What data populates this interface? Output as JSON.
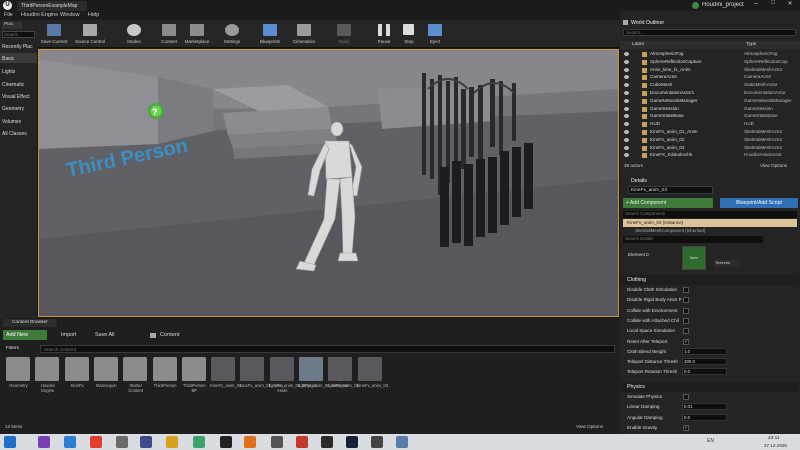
{
  "window": {
    "tab_title": "ThirdPersonExampleMap",
    "project_name": "Houdini_project",
    "menu": [
      "File",
      "Houdini Engine",
      "Window",
      "Help"
    ]
  },
  "modes_panel": {
    "tab": "Plac",
    "search_placeholder": "Search",
    "items": [
      "Recently Plac",
      "Basic",
      "Lights",
      "Cinematic",
      "Visual Effect",
      "Geometry",
      "Volumes",
      "All Classes"
    ]
  },
  "toolbar": {
    "buttons": [
      "Save Current",
      "Source Control",
      "Modes",
      "Content",
      "Marketplace",
      "Settings",
      "Blueprints",
      "Cinematics",
      "Build",
      "Pause",
      "Stop",
      "Eject"
    ]
  },
  "viewport": {
    "floor_text": "Third Person",
    "help_marker": "?"
  },
  "world_outliner": {
    "title": "World Outliner",
    "search_placeholder": "Search...",
    "col_label": "Label",
    "col_type": "Type",
    "rows": [
      {
        "label": "AtmosphericFog",
        "type": "AtmosphericFog"
      },
      {
        "label": "SphereReflectionCapture",
        "type": "SphereReflectionCap"
      },
      {
        "label": "Anim_kine_fx_Anim",
        "type": "SkeletalMeshActor"
      },
      {
        "label": "CameraActor",
        "type": "CameraActor"
      },
      {
        "label": "CubeMesh",
        "type": "StaticMeshActor"
      },
      {
        "label": "DocumentationActor1",
        "type": "DocumentationActor"
      },
      {
        "label": "GameNetworkManager",
        "type": "GameNetworkManager"
      },
      {
        "label": "GameSession",
        "type": "GameSession"
      },
      {
        "label": "GameStateBase",
        "type": "GameStateBase"
      },
      {
        "label": "HUD",
        "type": "HUD"
      },
      {
        "label": "KineFx_anim_01_Anim",
        "type": "SkeletalMeshActor"
      },
      {
        "label": "KineFx_anim_02",
        "type": "SkeletalMeshActor"
      },
      {
        "label": "KineFx_anim_03",
        "type": "SkeletalMeshActor"
      },
      {
        "label": "KineFX_Kilokolmchk",
        "type": "HoudiniAssetActor"
      }
    ],
    "actor_count": "39 actors",
    "view_options": "View Options"
  },
  "details": {
    "title": "Details",
    "selected_name": "KineFx_anim_03",
    "add_component": "+ Add Component",
    "blueprint_button": "Blueprint/Add Script",
    "search_components_placeholder": "Search Components",
    "component_instance": "KineFx_anim_03 (Instance)",
    "component_child": "SkeletalMeshComponent (Inherited)",
    "search_details_placeholder": "Search Details",
    "element_label": "Element 0",
    "element_thumb_text": "None",
    "element_dropdown": "Textures",
    "clothing_header": "Clothing",
    "clothing_rows": [
      {
        "label": "Disable Cloth Simulation",
        "kind": "check"
      },
      {
        "label": "Disable Rigid Body Anim P",
        "kind": "check"
      },
      {
        "label": "Collide with Environment",
        "kind": "check"
      },
      {
        "label": "Collide with Attached Chil",
        "kind": "check"
      },
      {
        "label": "Local Space Simulation",
        "kind": "check"
      },
      {
        "label": "Reset After Teleport",
        "kind": "check",
        "checked": true
      },
      {
        "label": "Cloth Blend Weight",
        "kind": "number",
        "value": "1.0"
      },
      {
        "label": "Teleport Distance Thresh",
        "kind": "number",
        "value": "300.0"
      },
      {
        "label": "Teleport Rotation Thresh",
        "kind": "number",
        "value": "0.0"
      }
    ],
    "physics_header": "Physics",
    "physics_rows": [
      {
        "label": "Simulate Physics",
        "kind": "check"
      },
      {
        "label": "Linear Damping",
        "kind": "number",
        "value": "0.01"
      },
      {
        "label": "Angular Damping",
        "kind": "number",
        "value": "0.0"
      },
      {
        "label": "Enable Gravity",
        "kind": "check",
        "checked": true
      }
    ]
  },
  "content_browser": {
    "tab": "Content Browser",
    "add_new": "Add New",
    "import": "Import",
    "save_all": "Save All",
    "path": "Content",
    "filters": "Filters",
    "search_placeholder": "Search Content",
    "assets": [
      {
        "name": "Geometry",
        "kind": "folder"
      },
      {
        "name": "Houdini Engine",
        "kind": "folder"
      },
      {
        "name": "KineFx",
        "kind": "folder"
      },
      {
        "name": "Mannequin",
        "kind": "folder"
      },
      {
        "name": "Starter Content",
        "kind": "folder"
      },
      {
        "name": "ThirdPerson",
        "kind": "folder"
      },
      {
        "name": "ThirdPerson BP",
        "kind": "folder"
      },
      {
        "name": "KineFx_anim_01",
        "kind": "mesh"
      },
      {
        "name": "KineFx_anim_01_Anim",
        "kind": "mesh"
      },
      {
        "name": "KineFx_anim_02_Physics Asset",
        "kind": "mesh"
      },
      {
        "name": "KineFx_anim_01_Skeleton",
        "kind": "skeleton"
      },
      {
        "name": "KineFx_anim_02",
        "kind": "mesh"
      },
      {
        "name": "KineFx_anim_03",
        "kind": "mesh"
      }
    ],
    "item_count": "13 items",
    "view_options": "View Options"
  },
  "taskbar": {
    "lang": "EN",
    "time": "23:11",
    "date": "27.12.2020"
  }
}
